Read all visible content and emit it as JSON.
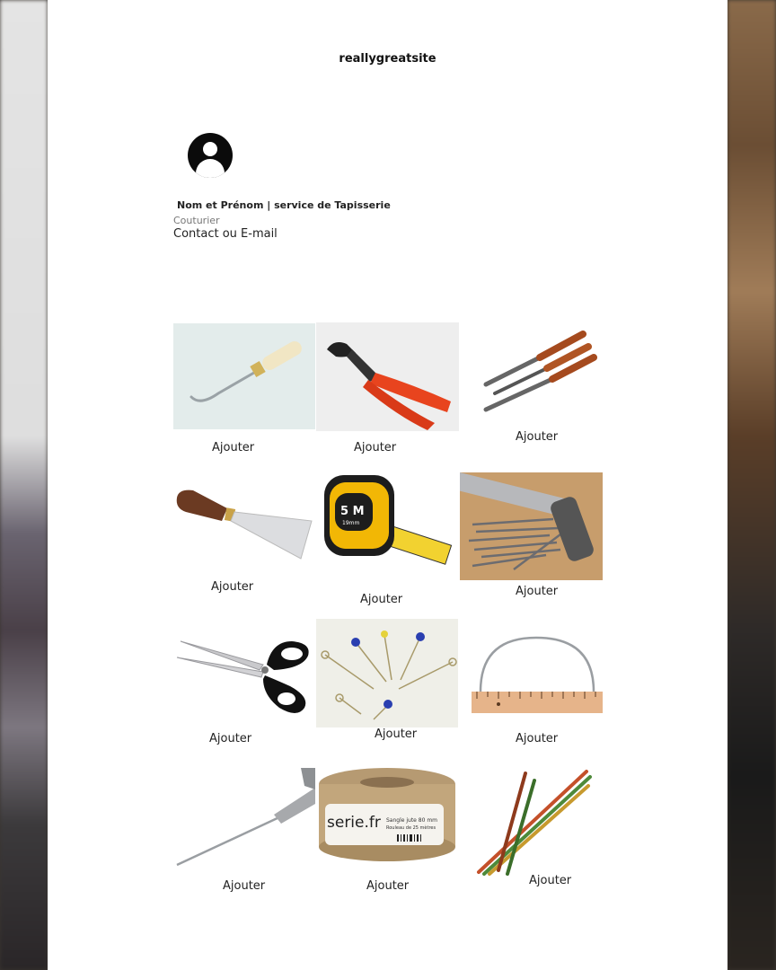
{
  "header": {
    "site": "reallygreatsite"
  },
  "profile": {
    "avatar_icon": "user-avatar-icon",
    "name": "Nom et Prénom | service de Tapisserie",
    "role": "Couturier",
    "contact": "Contact ou E-mail"
  },
  "products": [
    {
      "icon": "curved-needle-tool-icon",
      "add_label": "Ajouter"
    },
    {
      "icon": "end-cutting-pliers-icon",
      "add_label": "Ajouter"
    },
    {
      "icon": "files-set-icon",
      "add_label": "Ajouter"
    },
    {
      "icon": "putty-knife-icon",
      "add_label": "Ajouter"
    },
    {
      "icon": "tape-measure-icon",
      "add_label": "Ajouter",
      "tape_text": "5 M",
      "tape_subtext": "19mm"
    },
    {
      "icon": "hammer-and-nails-icon",
      "add_label": "Ajouter"
    },
    {
      "icon": "scissors-icon",
      "add_label": "Ajouter"
    },
    {
      "icon": "pins-icon",
      "add_label": "Ajouter"
    },
    {
      "icon": "half-circle-ruler-icon",
      "add_label": "Ajouter"
    },
    {
      "icon": "regulator-needle-icon",
      "add_label": "Ajouter"
    },
    {
      "icon": "jute-webbing-roll-icon",
      "add_label": "Ajouter",
      "brand": "serie.fr",
      "label_line1": "Sangle jute 80 mm",
      "label_line2": "Rouleau de 25 mètres"
    },
    {
      "icon": "knitting-needles-icon",
      "add_label": "Ajouter"
    }
  ],
  "colors": {
    "page": "#ffffff",
    "text": "#222222",
    "pliers_grip": "#e8441e",
    "tape_case": "#f2b705",
    "wood": "#b5652a"
  }
}
